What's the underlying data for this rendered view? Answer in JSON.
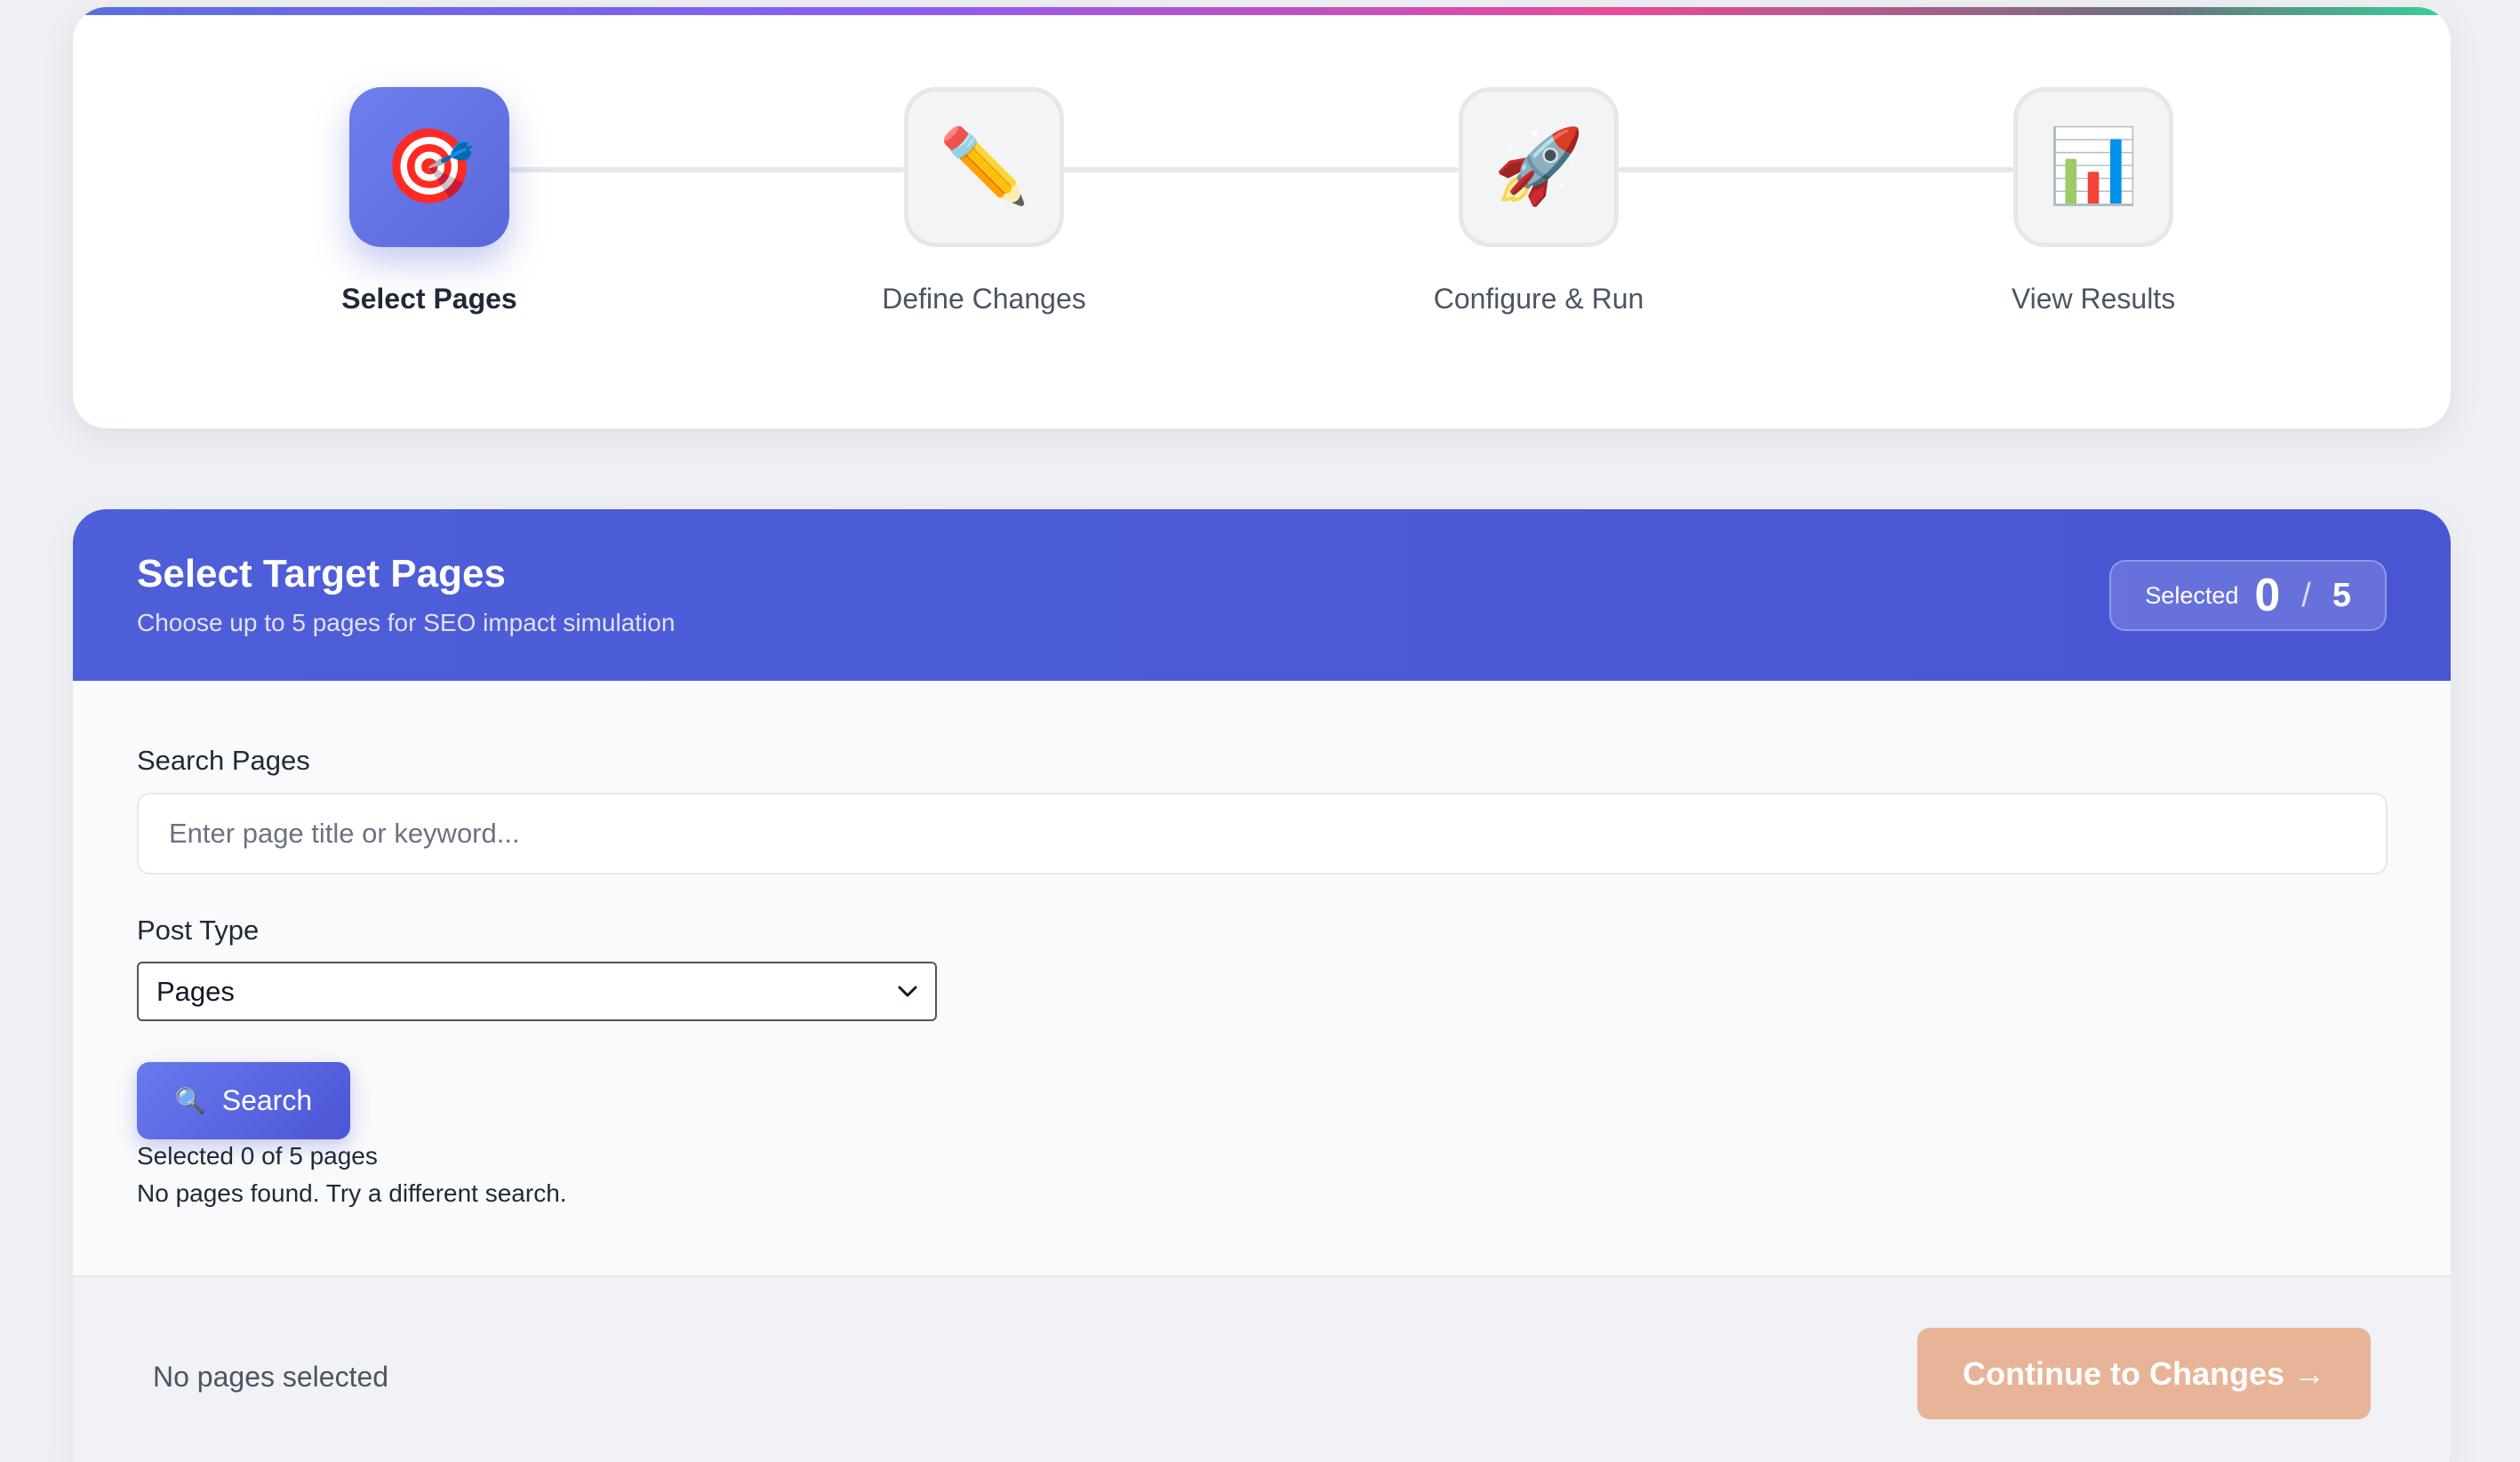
{
  "stepper": {
    "steps": [
      {
        "label": "Select Pages",
        "icon": "🎯",
        "icon_name": "target-icon",
        "active": true
      },
      {
        "label": "Define Changes",
        "icon": "✏️",
        "icon_name": "pencil-icon",
        "active": false
      },
      {
        "label": "Configure & Run",
        "icon": "🚀",
        "icon_name": "rocket-icon",
        "active": false
      },
      {
        "label": "View Results",
        "icon": "📊",
        "icon_name": "bar-chart-icon",
        "active": false
      }
    ]
  },
  "panel": {
    "title": "Select Target Pages",
    "subtitle": "Choose up to 5 pages for SEO impact simulation",
    "counter": {
      "label": "Selected",
      "count": "0",
      "separator": "/",
      "max": "5"
    }
  },
  "search": {
    "label": "Search Pages",
    "placeholder": "Enter page title or keyword...",
    "value": ""
  },
  "post_type": {
    "label": "Post Type",
    "selected": "Pages"
  },
  "search_button": {
    "label": "Search",
    "icon": "🔍"
  },
  "results": {
    "selected_text": "Selected 0 of 5 pages",
    "empty_text": "No pages found. Try a different search."
  },
  "footer": {
    "status": "No pages selected",
    "continue_label": "Continue to Changes →"
  },
  "colors": {
    "accent": "#4e5fd9",
    "continue_disabled": "#e8b497",
    "page_bg": "#eef0f4"
  }
}
